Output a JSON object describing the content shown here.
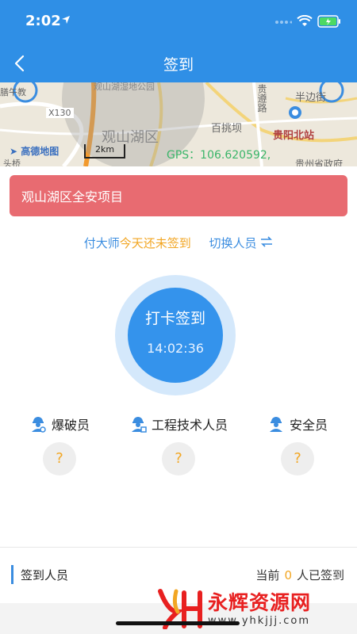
{
  "status_bar": {
    "time": "2:02"
  },
  "nav": {
    "title": "签到"
  },
  "map": {
    "district": "观山湖区",
    "park": "观山湖湿地公园",
    "road_code": "X130",
    "poi_left": "膳午教",
    "poi_baitiao": "百挑坝",
    "poi_banbian": "半边街",
    "road_vertical": "贵遵路",
    "station": "贵阳北站",
    "gov": "贵州省政府",
    "bottom_left": "头桥",
    "logo": "高德地图",
    "scale": "2km",
    "gps": "GPS：106.620592,"
  },
  "project": {
    "name": "观山湖区全安项目"
  },
  "status": {
    "person": "付大师",
    "message": "今天还未签到",
    "switch_label": "切换人员"
  },
  "checkin": {
    "label": "打卡签到",
    "time": "14:02:36"
  },
  "roles": [
    {
      "label": "爆破员",
      "value": "?"
    },
    {
      "label": "工程技术人员",
      "value": "?"
    },
    {
      "label": "安全员",
      "value": "?"
    }
  ],
  "footer": {
    "title": "签到人员",
    "prefix": "当前",
    "count": "0",
    "suffix": "人已签到"
  },
  "watermark": {
    "text": "永辉资源网",
    "url": "www.yhkjjj.com"
  },
  "colors": {
    "primary": "#2f8fe6",
    "banner": "#e86b71",
    "accent": "#f2a623",
    "gps": "#3ab569"
  }
}
